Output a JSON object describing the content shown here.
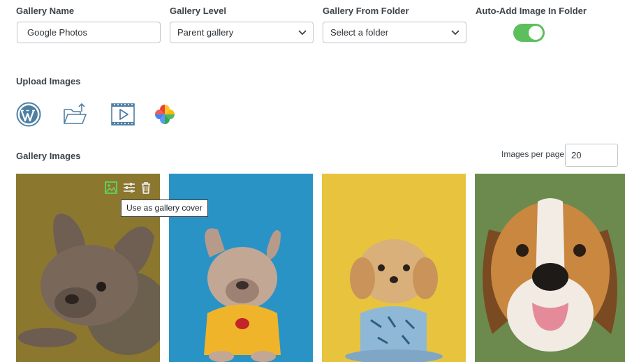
{
  "fields": {
    "gallery_name": {
      "label": "Gallery Name",
      "value": "Google Photos"
    },
    "gallery_level": {
      "label": "Gallery Level",
      "value": "Parent gallery"
    },
    "gallery_from_folder": {
      "label": "Gallery From Folder",
      "value": "Select a folder"
    },
    "auto_add": {
      "label": "Auto-Add Image In Folder",
      "enabled": true
    }
  },
  "upload": {
    "title": "Upload Images",
    "sources": [
      "wordpress-icon",
      "folder-upload-icon",
      "video-icon",
      "google-photos-icon"
    ]
  },
  "gallery": {
    "title": "Gallery Images",
    "per_page_label": "Images per page",
    "per_page_value": "20",
    "tooltip": "Use as gallery cover",
    "image_tools": [
      "set-cover-icon",
      "adjust-icon",
      "trash-icon"
    ],
    "images": [
      {
        "name": "french-bulldog-lying",
        "bg": "#a89036"
      },
      {
        "name": "french-bulldog-yellow-shirt",
        "bg": "#2a8fc0"
      },
      {
        "name": "shih-poo-pajamas",
        "bg": "#e6c23a"
      },
      {
        "name": "beagle-closeup",
        "bg": "#6f8a52"
      }
    ]
  },
  "colors": {
    "toggle_on": "#5cbf5c",
    "icon_blue": "#4f7fa3",
    "cover_green": "#5fd35f"
  }
}
